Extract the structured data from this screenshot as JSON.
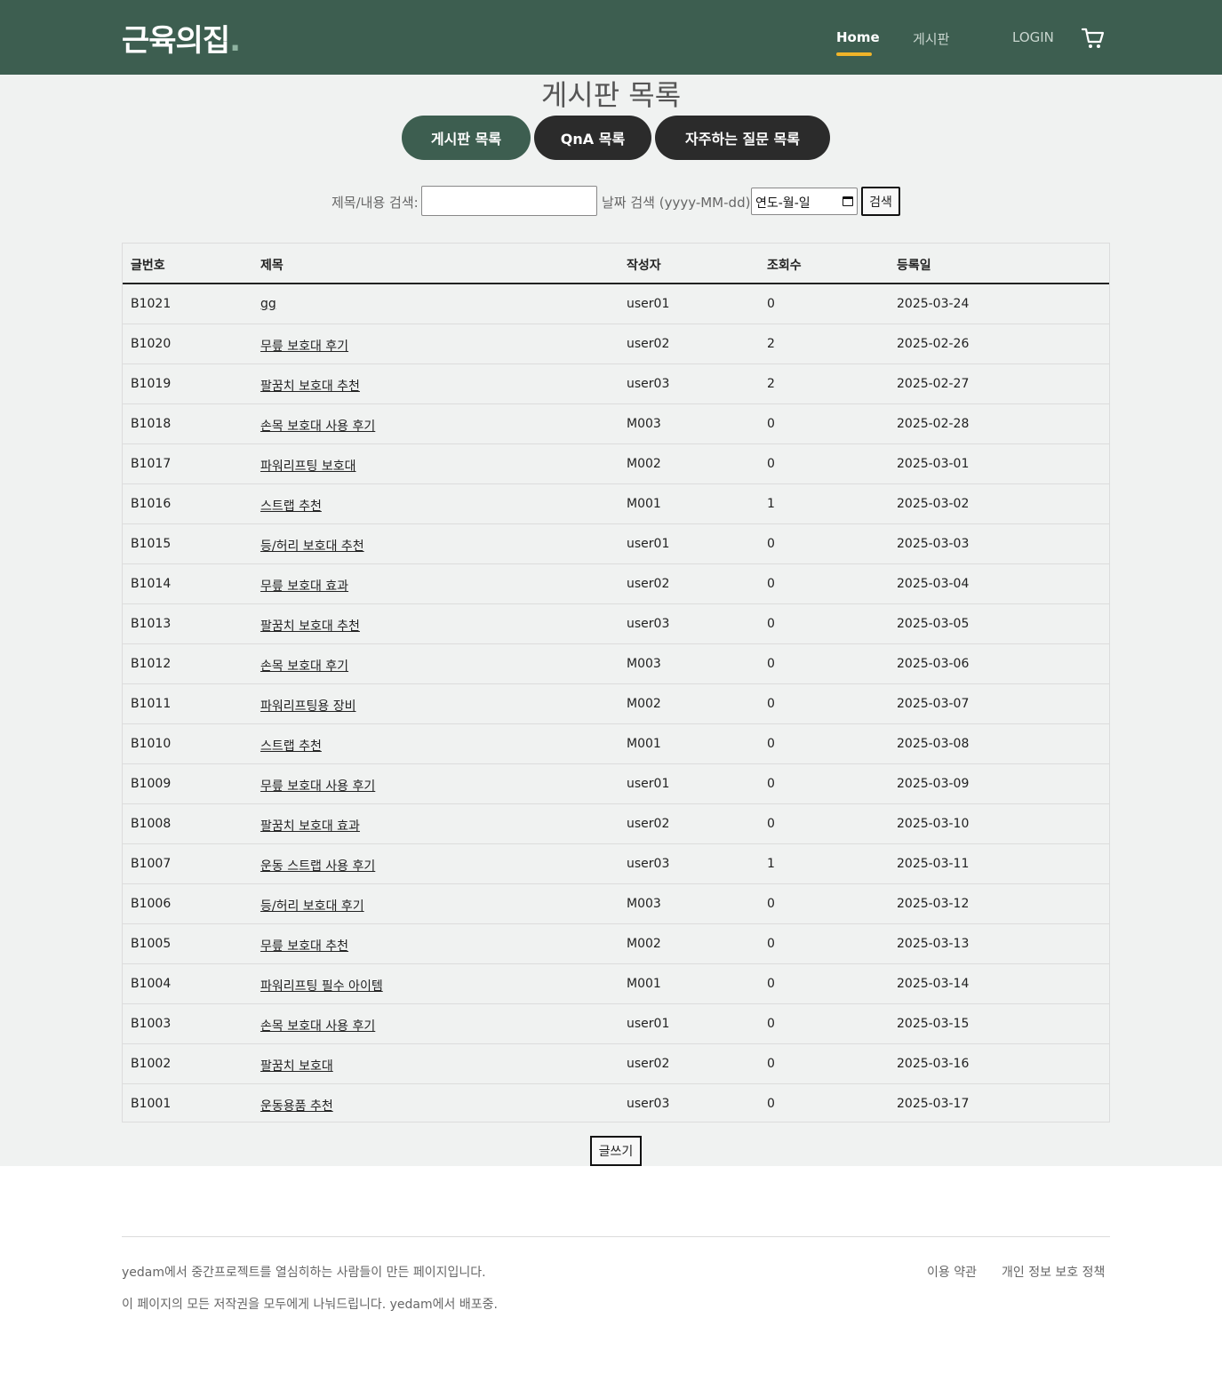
{
  "header": {
    "logo": "근육의집",
    "logo_dot": ".",
    "nav": {
      "home": "Home",
      "board": "게시판",
      "login": "LOGIN"
    },
    "accent_color": "#f0b429",
    "bg_color": "#3d5e50"
  },
  "page_title": "게시판 목록",
  "tabs": {
    "board": "게시판 목록",
    "qna": "QnA 목록",
    "faq": "자주하는 질문 목록"
  },
  "search": {
    "title_label": "제목/내용 검색:",
    "title_value": "",
    "date_label": "날짜 검색 (yyyy-MM-dd):",
    "date_placeholder": "연도-월-일",
    "button": "검색"
  },
  "table": {
    "headers": [
      "글번호",
      "제목",
      "작성자",
      "조회수",
      "등록일"
    ],
    "rows": [
      [
        "B1021",
        "gg",
        "user01",
        "0",
        "2025-03-24"
      ],
      [
        "B1020",
        "무릎 보호대 후기",
        "user02",
        "2",
        "2025-02-26"
      ],
      [
        "B1019",
        "팔꿈치 보호대 추천",
        "user03",
        "2",
        "2025-02-27"
      ],
      [
        "B1018",
        "손목 보호대 사용 후기",
        "M003",
        "0",
        "2025-02-28"
      ],
      [
        "B1017",
        "파워리프팅 보호대",
        "M002",
        "0",
        "2025-03-01"
      ],
      [
        "B1016",
        "스트랩 추천",
        "M001",
        "1",
        "2025-03-02"
      ],
      [
        "B1015",
        "등/허리 보호대 추천",
        "user01",
        "0",
        "2025-03-03"
      ],
      [
        "B1014",
        "무릎 보호대 효과",
        "user02",
        "0",
        "2025-03-04"
      ],
      [
        "B1013",
        "팔꿈치 보호대 추천",
        "user03",
        "0",
        "2025-03-05"
      ],
      [
        "B1012",
        "손목 보호대 후기",
        "M003",
        "0",
        "2025-03-06"
      ],
      [
        "B1011",
        "파워리프팅용 장비",
        "M002",
        "0",
        "2025-03-07"
      ],
      [
        "B1010",
        "스트랩 추천",
        "M001",
        "0",
        "2025-03-08"
      ],
      [
        "B1009",
        "무릎 보호대 사용 후기",
        "user01",
        "0",
        "2025-03-09"
      ],
      [
        "B1008",
        "팔꿈치 보호대 효과",
        "user02",
        "0",
        "2025-03-10"
      ],
      [
        "B1007",
        "운동 스트랩 사용 후기",
        "user03",
        "1",
        "2025-03-11"
      ],
      [
        "B1006",
        "등/허리 보호대 후기",
        "M003",
        "0",
        "2025-03-12"
      ],
      [
        "B1005",
        "무릎 보호대 추천",
        "M002",
        "0",
        "2025-03-13"
      ],
      [
        "B1004",
        "파워리프팅 필수 아이템",
        "M001",
        "0",
        "2025-03-14"
      ],
      [
        "B1003",
        "손목 보호대 사용 후기",
        "user01",
        "0",
        "2025-03-15"
      ],
      [
        "B1002",
        "팔꿈치 보호대",
        "user02",
        "0",
        "2025-03-16"
      ],
      [
        "B1001",
        "운동용품 추천",
        "user03",
        "0",
        "2025-03-17"
      ]
    ]
  },
  "write_button": "글쓰기",
  "footer": {
    "line1": "yedam에서 중간프로젝트를 열심히하는 사람들이 만든 페이지입니다.",
    "line2": "이 페이지의 모든 저작권을 모두에게 나눠드립니다. yedam에서 배포중.",
    "terms": "이용 약관",
    "privacy": "개인 정보 보호 정책"
  }
}
